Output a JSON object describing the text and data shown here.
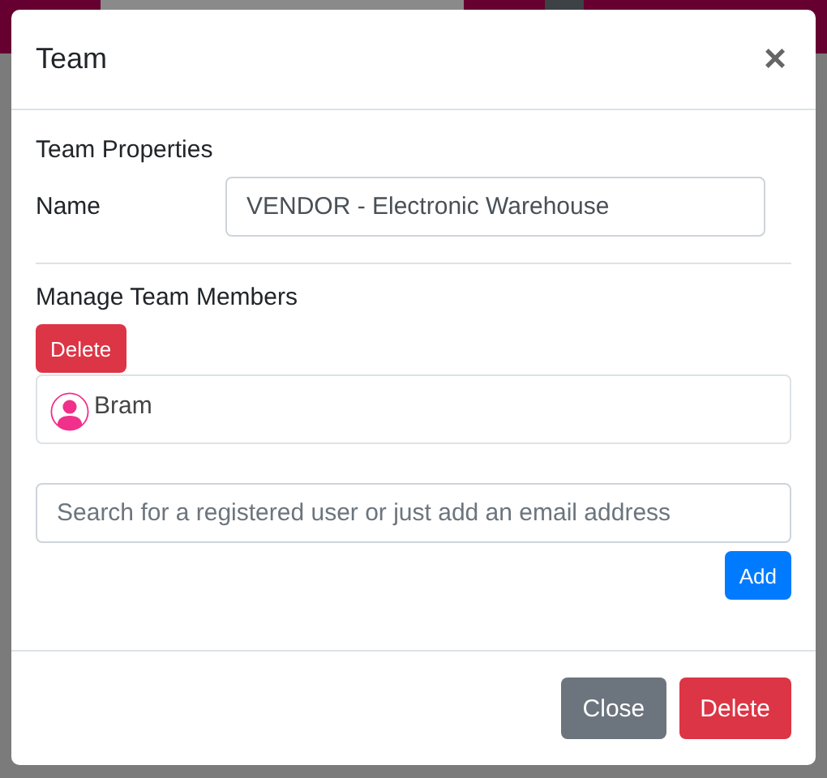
{
  "modal": {
    "title": "Team",
    "close": "×",
    "properties": {
      "heading": "Team Properties",
      "name_label": "Name",
      "name_value": "VENDOR - Electronic Warehouse"
    },
    "members": {
      "heading": "Manage Team Members",
      "delete_button": "Delete",
      "list": [
        {
          "name": "Bram"
        }
      ],
      "search": {
        "placeholder": "Search for a registered user or just add an email address"
      },
      "add_button": "Add"
    },
    "footer": [
      {
        "label": "Close",
        "kind": "secondary"
      },
      {
        "label": "Delete",
        "kind": "danger"
      }
    ]
  }
}
